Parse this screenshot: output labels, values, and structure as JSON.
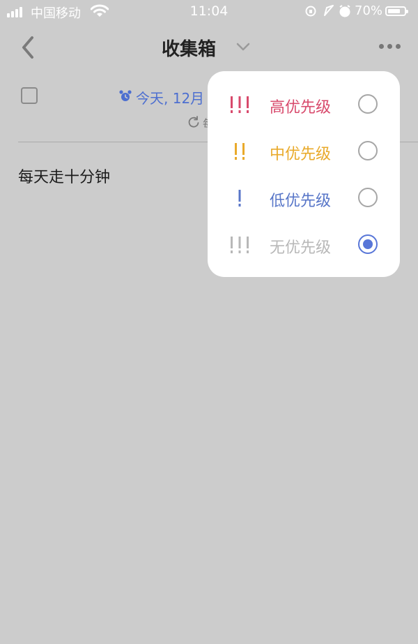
{
  "status_bar": {
    "carrier": "中国移动",
    "time": "11:04",
    "battery": "70%"
  },
  "header": {
    "title": "收集箱"
  },
  "task": {
    "due": "今天, 12月",
    "repeat": "每",
    "title": "每天走十分钟"
  },
  "priority_menu": {
    "options": [
      {
        "marks": "!!!",
        "label": "高优先级",
        "color": "#d84a6c",
        "selected": false
      },
      {
        "marks": "!!",
        "label": "中优先级",
        "color": "#e9aa2b",
        "selected": false
      },
      {
        "marks": "!",
        "label": "低优先级",
        "color": "#5876c8",
        "selected": false
      },
      {
        "marks": "!!!",
        "label": "无优先级",
        "color": "#b8b8b8",
        "selected": true
      }
    ]
  },
  "colors": {
    "accent": "#5876d8",
    "background": "#cccccc"
  }
}
